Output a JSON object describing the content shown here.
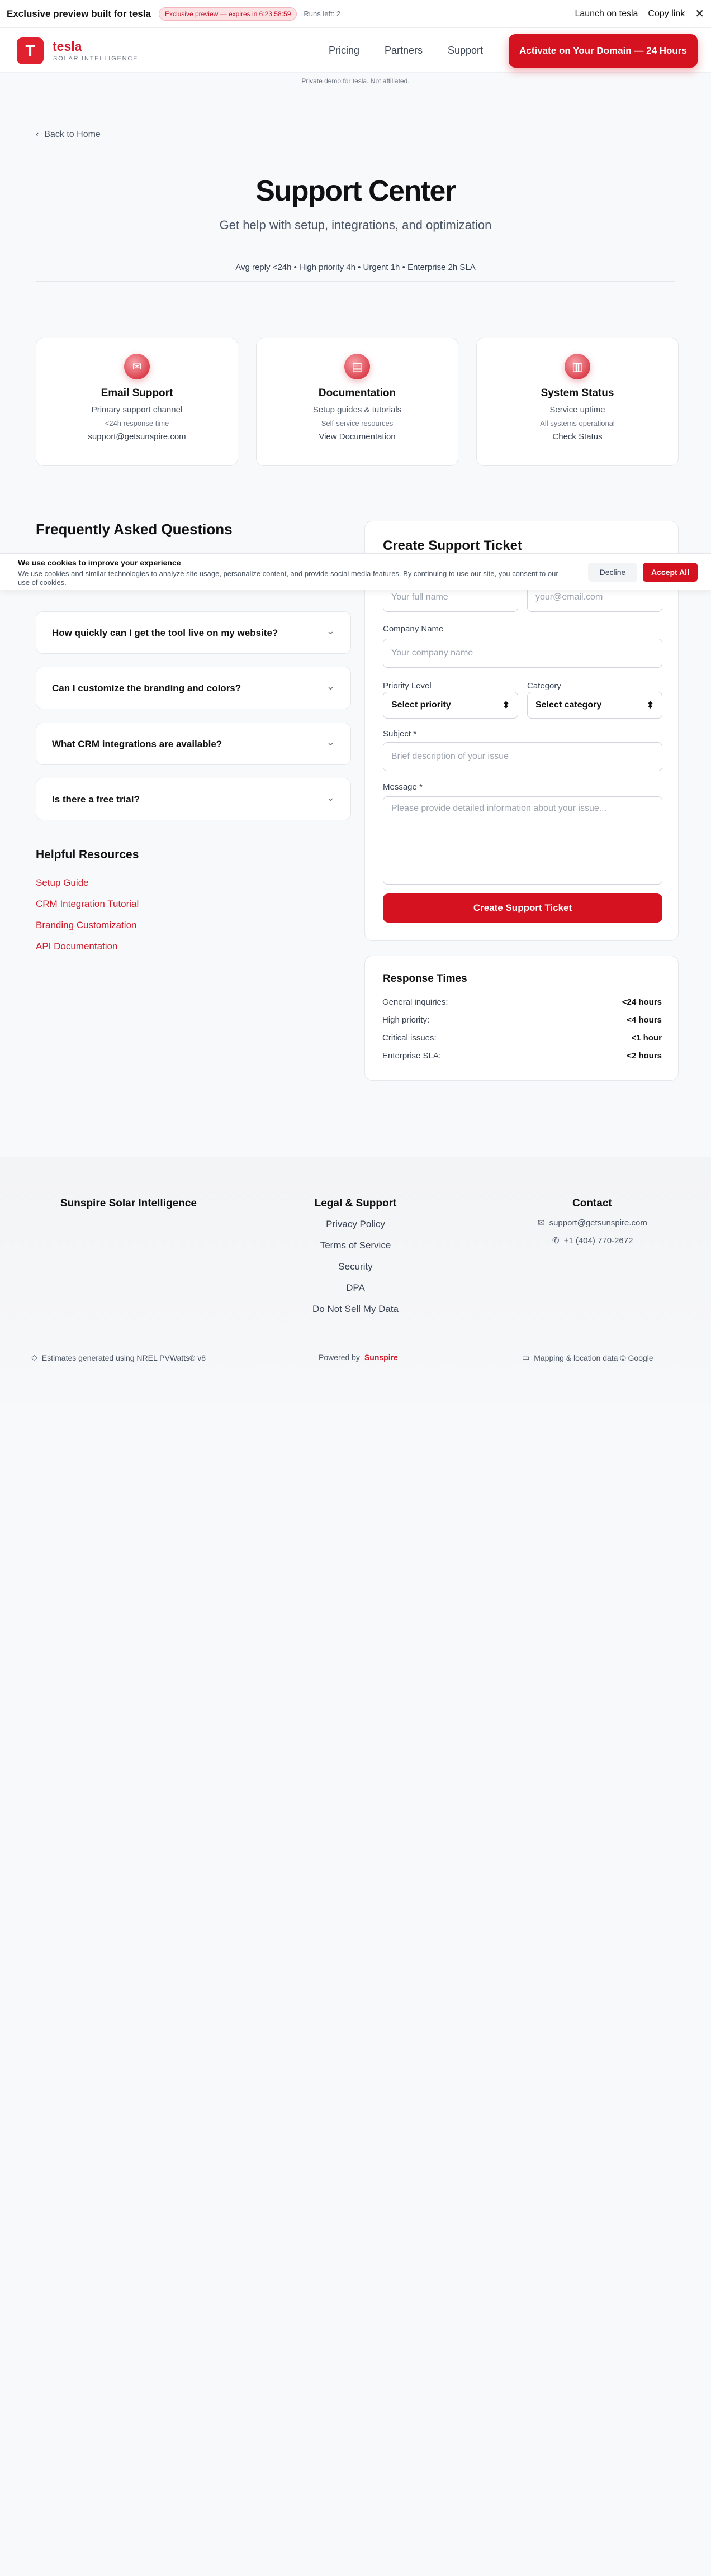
{
  "banner": {
    "title": "Exclusive preview built for tesla",
    "pill": "Exclusive preview — expires in 6:23:58:59",
    "runs": "Runs left: 2",
    "launch": "Launch on tesla",
    "copy": "Copy link",
    "close_icon": "close-icon"
  },
  "header": {
    "logo_letter": "T",
    "brand": "tesla",
    "subtitle": "SOLAR INTELLIGENCE",
    "nav": [
      "Pricing",
      "Partners",
      "Support"
    ],
    "cta": "Activate on Your Domain — 24 Hours",
    "disclaimer": "Private demo for tesla. Not affiliated."
  },
  "page": {
    "back": "Back to Home",
    "title": "Support Center",
    "subtitle": "Get help with setup, integrations, and optimization",
    "sla": "Avg reply <24h • High priority 4h • Urgent 1h • Enterprise 2h SLA"
  },
  "cards": [
    {
      "icon": "mail-icon",
      "title": "Email Support",
      "line1": "Primary support channel",
      "line2": "<24h response time",
      "line3": "support@getsunspire.com"
    },
    {
      "icon": "document-icon",
      "title": "Documentation",
      "line1": "Setup guides & tutorials",
      "line2": "Self-service resources",
      "line3": "View Documentation"
    },
    {
      "icon": "chart-icon",
      "title": "System Status",
      "line1": "Service uptime",
      "line2": "All systems operational",
      "line3": "Check Status"
    }
  ],
  "faq": {
    "title": "Frequently Asked Questions",
    "items": [
      "How quickly can I get the tool live on my website?",
      "Can I customize the branding and colors?",
      "What CRM integrations are available?",
      "Is there a free trial?"
    ]
  },
  "resources": {
    "title": "Helpful Resources",
    "links": [
      "Setup Guide",
      "CRM Integration Tutorial",
      "Branding Customization",
      "API Documentation"
    ]
  },
  "ticket": {
    "title": "Create Support Ticket",
    "name_placeholder": "Your full name",
    "email_placeholder": "your@email.com",
    "company_label": "Company Name",
    "company_placeholder": "Your company name",
    "priority_label": "Priority Level",
    "priority_value": "Select priority",
    "category_label": "Category",
    "category_value": "Select category",
    "subject_label": "Subject *",
    "subject_placeholder": "Brief description of your issue",
    "message_label": "Message *",
    "message_placeholder": "Please provide detailed information about your issue...",
    "submit": "Create Support Ticket"
  },
  "response_times": {
    "title": "Response Times",
    "rows": [
      {
        "label": "General inquiries:",
        "value": "<24 hours"
      },
      {
        "label": "High priority:",
        "value": "<4 hours"
      },
      {
        "label": "Critical issues:",
        "value": "<1 hour"
      },
      {
        "label": "Enterprise SLA:",
        "value": "<2 hours"
      }
    ]
  },
  "footer": {
    "brand": "Sunspire Solar Intelligence",
    "legal_title": "Legal & Support",
    "legal_links": [
      "Privacy Policy",
      "Terms of Service",
      "Security",
      "DPA",
      "Do Not Sell My Data"
    ],
    "contact_title": "Contact",
    "email": "support@getsunspire.com",
    "phone": "+1 (404) 770-2672",
    "estimates": "Estimates generated using NREL PVWatts® v8",
    "powered_by": "Powered by",
    "powered_brand": "Sunspire",
    "mapping": "Mapping & location data © Google"
  },
  "cookie": {
    "title": "We use cookies to improve your experience",
    "text": "We use cookies and similar technologies to analyze site usage, personalize content, and provide social media features. By continuing to use our site, you consent to our use of cookies.",
    "decline": "Decline",
    "accept": "Accept All"
  },
  "colors": {
    "brand": "#d5121f",
    "brand_text": "#d11a29",
    "background": "#f8f9fb"
  }
}
